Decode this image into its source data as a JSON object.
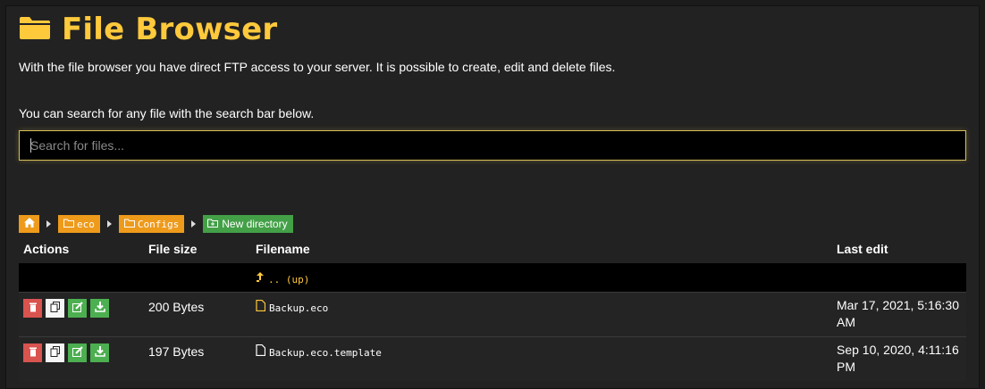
{
  "header": {
    "title": "File Browser",
    "description": "With the file browser you have direct FTP access to your server. It is possible to create, edit and delete files.",
    "search_hint": "You can search for any file with the search bar below."
  },
  "search": {
    "placeholder": "Search for files...",
    "value": ""
  },
  "breadcrumb": {
    "items": [
      "eco",
      "Configs"
    ],
    "new_directory_label": "New directory"
  },
  "table": {
    "columns": [
      "Actions",
      "File size",
      "Filename",
      "Last edit"
    ],
    "up_label": ".. (up)",
    "rows": [
      {
        "size": "200 Bytes",
        "filename": "Backup.eco",
        "last_edit": "Mar 17, 2021, 5:16:30 AM",
        "icon": "file-icon-yellow"
      },
      {
        "size": "197 Bytes",
        "filename": "Backup.eco.template",
        "last_edit": "Sep 10, 2020, 4:11:16 PM",
        "icon": "file-icon-white"
      }
    ]
  },
  "colors": {
    "accent": "#ffc93c",
    "crumb": "#ee9a1b",
    "success": "#43a047",
    "danger": "#d9534f",
    "panel": "#222222"
  }
}
